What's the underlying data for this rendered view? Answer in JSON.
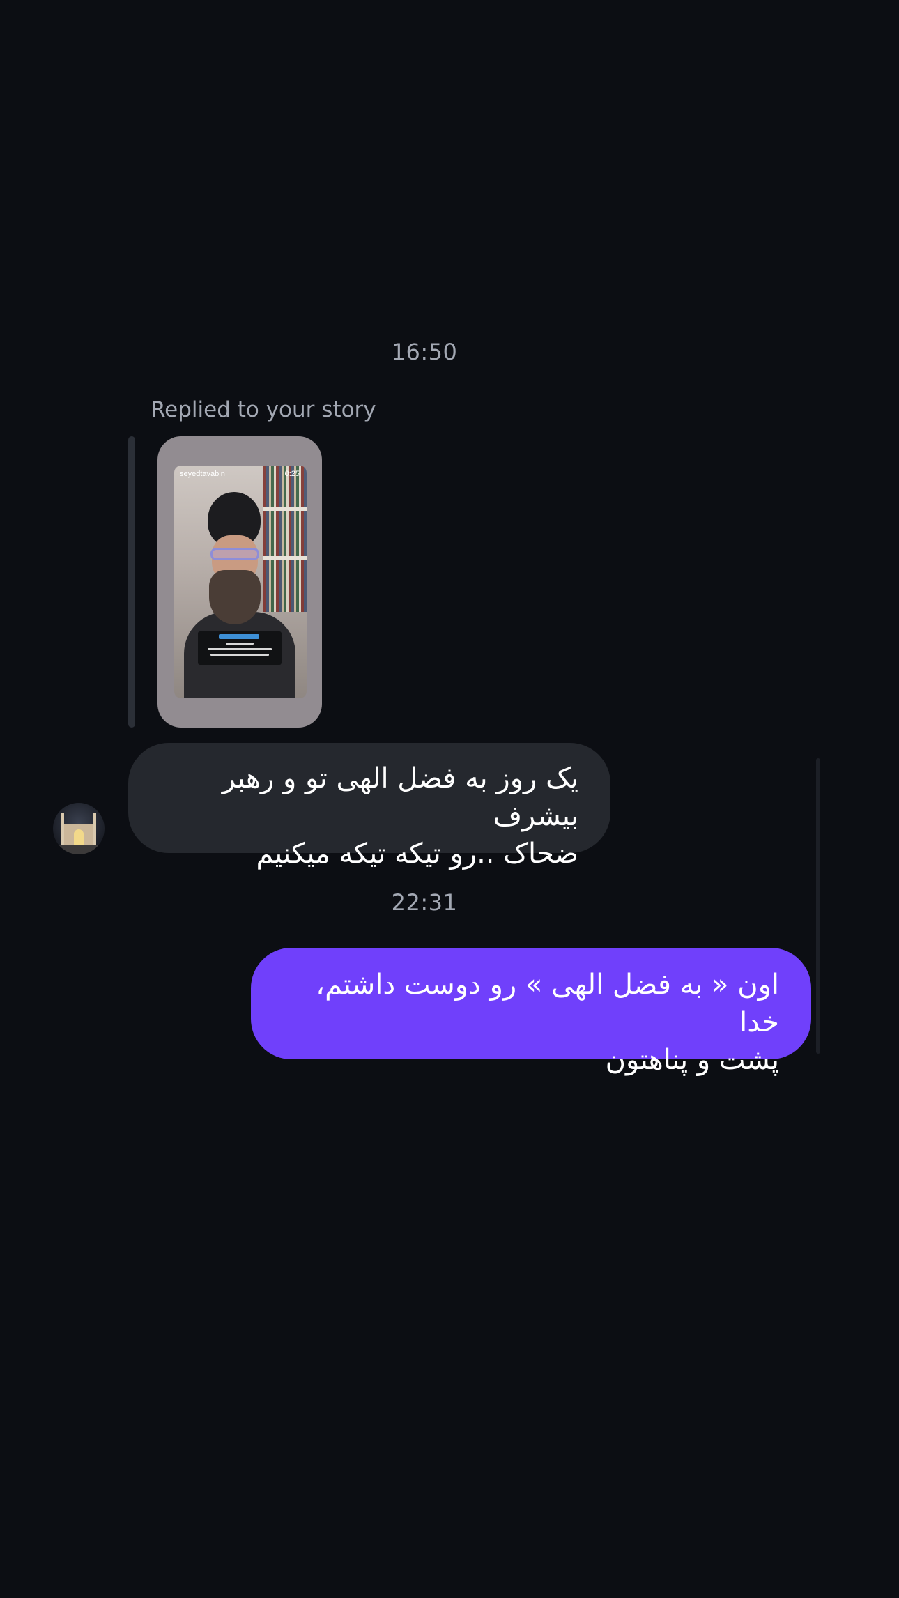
{
  "conversation": {
    "timestamps": [
      "16:50",
      "22:31"
    ],
    "story_reply": {
      "caption": "Replied to your story",
      "story_username": "seyedtavabin",
      "story_duration": "0:25"
    },
    "messages": [
      {
        "sender": "contact",
        "text": "یک روز به فضل الهی تو و رهبر بیشرف\nضحاک ..رو تیکه تیکه میکنیم"
      },
      {
        "sender": "me",
        "text": "اون « به فضل الهی » رو دوست داشتم، خدا\nپشت و پناهتون"
      }
    ]
  },
  "colors": {
    "background": "#0c0e13",
    "incoming_bubble": "#25282e",
    "outgoing_bubble": "#7040fb",
    "secondary_text": "#a3a8b3"
  },
  "icons": {
    "avatar": "mosque-night-photo"
  }
}
